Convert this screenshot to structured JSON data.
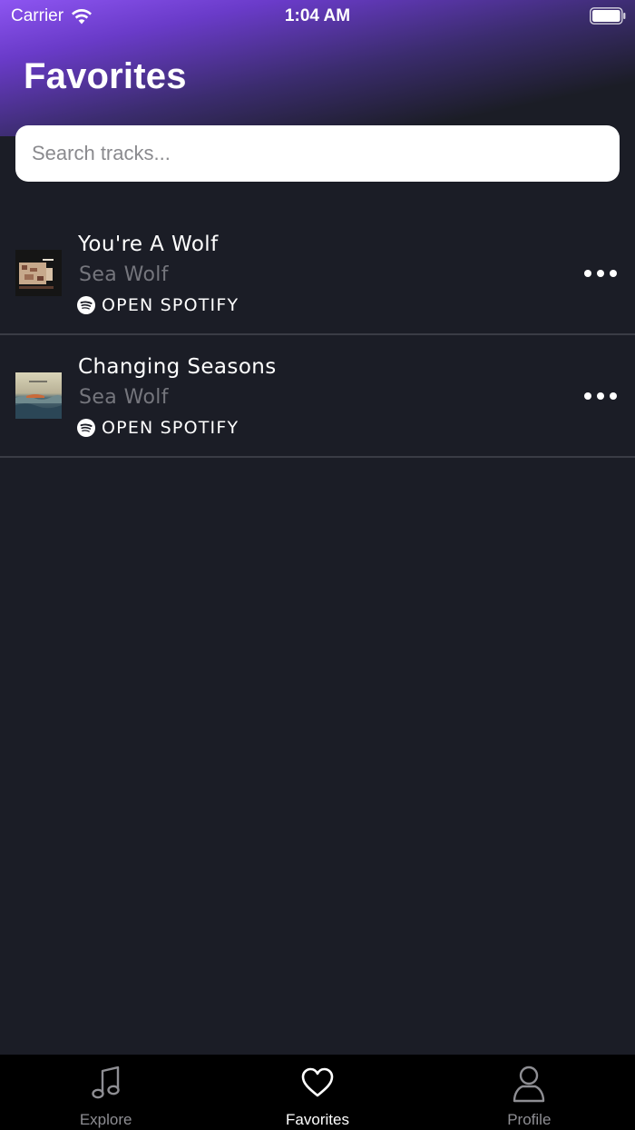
{
  "status_bar": {
    "carrier": "Carrier",
    "time": "1:04 AM"
  },
  "header": {
    "title": "Favorites"
  },
  "search": {
    "placeholder": "Search tracks..."
  },
  "tracks": [
    {
      "title": "You're A Wolf",
      "artist": "Sea Wolf",
      "action_label": "OPEN SPOTIFY",
      "album_art": "album-art-youre-a-wolf"
    },
    {
      "title": "Changing Seasons",
      "artist": "Sea Wolf",
      "action_label": "OPEN SPOTIFY",
      "album_art": "album-art-changing-seasons"
    }
  ],
  "tab_bar": {
    "tabs": [
      {
        "label": "Explore",
        "icon": "music-note-icon",
        "active": false
      },
      {
        "label": "Favorites",
        "icon": "heart-icon",
        "active": true
      },
      {
        "label": "Profile",
        "icon": "person-icon",
        "active": false
      }
    ]
  },
  "colors": {
    "background": "#1b1d26",
    "accent_purple": "#8d55f1",
    "tab_bar": "#000000",
    "secondary_text": "#75767d"
  }
}
